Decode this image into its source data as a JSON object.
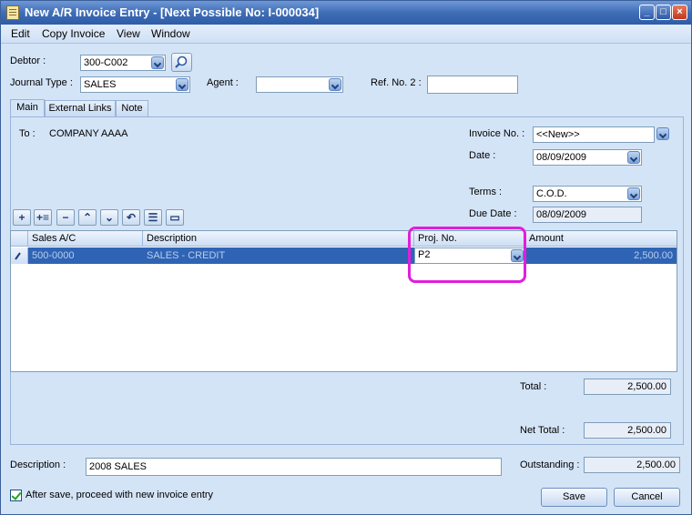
{
  "window": {
    "title": "New A/R Invoice Entry - [Next Possible No: I-000034]",
    "minimize": "_",
    "maximize": "□",
    "close": "×"
  },
  "menu": [
    "Edit",
    "Copy Invoice",
    "View",
    "Window"
  ],
  "header": {
    "debtor_label": "Debtor :",
    "debtor_value": "300-C002",
    "journal_label": "Journal Type :",
    "journal_value": "SALES",
    "agent_label": "Agent :",
    "agent_value": "",
    "ref2_label": "Ref. No. 2 :",
    "ref2_value": ""
  },
  "tabs": [
    "Main",
    "External Links",
    "Note"
  ],
  "main": {
    "to_label": "To :",
    "to_value": "COMPANY AAAA",
    "invoice_no_label": "Invoice No. :",
    "invoice_no_value": "<<New>>",
    "date_label": "Date :",
    "date_value": "08/09/2009",
    "terms_label": "Terms :",
    "terms_value": "C.O.D.",
    "due_date_label": "Due Date :",
    "due_date_value": "08/09/2009"
  },
  "toolbar_icons": [
    "add-row-icon",
    "insert-row-icon",
    "delete-row-icon",
    "move-up-icon",
    "move-down-icon",
    "undo-icon",
    "list-icon",
    "detail-icon"
  ],
  "grid": {
    "columns": [
      "Sales A/C",
      "Description",
      "Proj. No.",
      "Amount"
    ],
    "rows": [
      {
        "sales_ac": "500-0000",
        "description": "SALES - CREDIT",
        "proj_no": "P2",
        "amount": "2,500.00"
      }
    ]
  },
  "totals": {
    "total_label": "Total :",
    "total_value": "2,500.00",
    "net_total_label": "Net Total :",
    "net_total_value": "2,500.00",
    "outstanding_label": "Outstanding :",
    "outstanding_value": "2,500.00"
  },
  "footer": {
    "description_label": "Description :",
    "description_value": "2008 SALES",
    "after_save_label": "After save, proceed with new invoice entry",
    "after_save_checked": true,
    "save_label": "Save",
    "cancel_label": "Cancel"
  },
  "colors": {
    "title_bar": "#3f6db6",
    "window_bg": "#d4e4f7",
    "selected_row": "#2f64b5",
    "highlight": "#e01edc"
  }
}
